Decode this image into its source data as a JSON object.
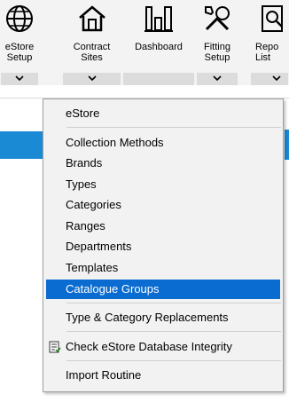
{
  "ribbon": {
    "buttons": [
      {
        "label": "eStore\nSetup",
        "icon": "globe-icon"
      },
      {
        "label": "Contract\nSites",
        "icon": "house-icon"
      },
      {
        "label": "Dashboard",
        "icon": "dashboard-icon"
      },
      {
        "label": "Fitting\nSetup",
        "icon": "tools-icon"
      },
      {
        "label": "Repo\nList",
        "icon": "report-icon"
      }
    ]
  },
  "menu": {
    "items": [
      {
        "label": "eStore"
      },
      {
        "label": "Collection Methods"
      },
      {
        "label": "Brands"
      },
      {
        "label": "Types"
      },
      {
        "label": "Categories"
      },
      {
        "label": "Ranges"
      },
      {
        "label": "Departments"
      },
      {
        "label": "Templates"
      },
      {
        "label": "Catalogue Groups",
        "selected": true
      },
      {
        "label": "Type & Category Replacements"
      },
      {
        "label": "Check eStore Database Integrity",
        "icon": "checklist-icon"
      },
      {
        "label": "Import Routine"
      }
    ]
  },
  "colors": {
    "selection": "#0a6cd1",
    "accent_strip": "#1a8ad4"
  }
}
